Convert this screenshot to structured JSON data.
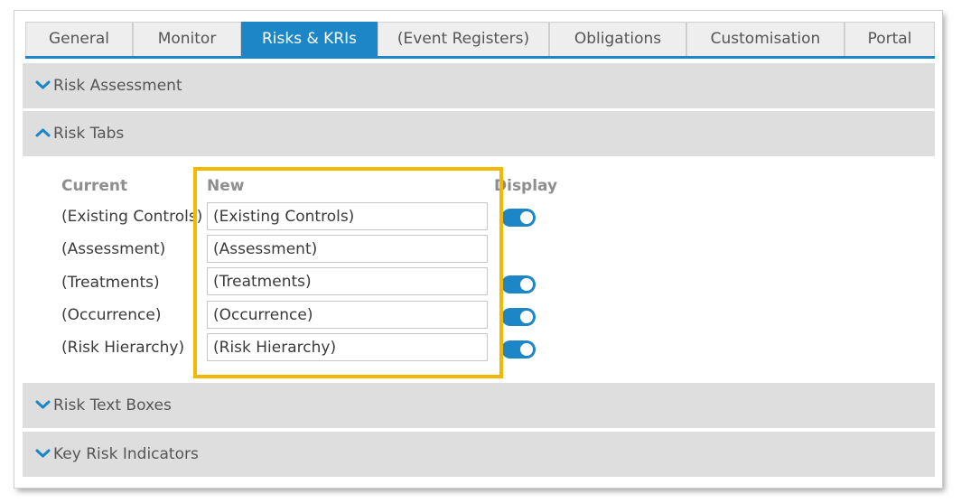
{
  "tabs": [
    {
      "label": "General"
    },
    {
      "label": "Monitor"
    },
    {
      "label": "Risks & KRIs"
    },
    {
      "label": "(Event Registers)"
    },
    {
      "label": "Obligations"
    },
    {
      "label": "Customisation"
    },
    {
      "label": "Portal"
    }
  ],
  "active_tab": "Risks & KRIs",
  "accent_color": "#1c86c6",
  "highlight_color": "#f5b800",
  "sections": {
    "risk_assessment": {
      "label": "Risk Assessment",
      "expanded": false
    },
    "risk_tabs": {
      "label": "Risk Tabs",
      "expanded": true
    },
    "risk_text_boxes": {
      "label": "Risk Text Boxes",
      "expanded": false
    },
    "key_risk_indicators": {
      "label": "Key Risk Indicators",
      "expanded": false
    }
  },
  "risk_tabs_table": {
    "headers": {
      "current": "Current",
      "new": "New",
      "display": "Display"
    },
    "rows": [
      {
        "current": "(Existing Controls)",
        "new": "(Existing Controls)",
        "display": true
      },
      {
        "current": "(Assessment)",
        "new": "(Assessment)",
        "display": null
      },
      {
        "current": "(Treatments)",
        "new": "(Treatments)",
        "display": true
      },
      {
        "current": "(Occurrence)",
        "new": "(Occurrence)",
        "display": true
      },
      {
        "current": "(Risk Hierarchy)",
        "new": "(Risk Hierarchy)",
        "display": true
      }
    ]
  }
}
